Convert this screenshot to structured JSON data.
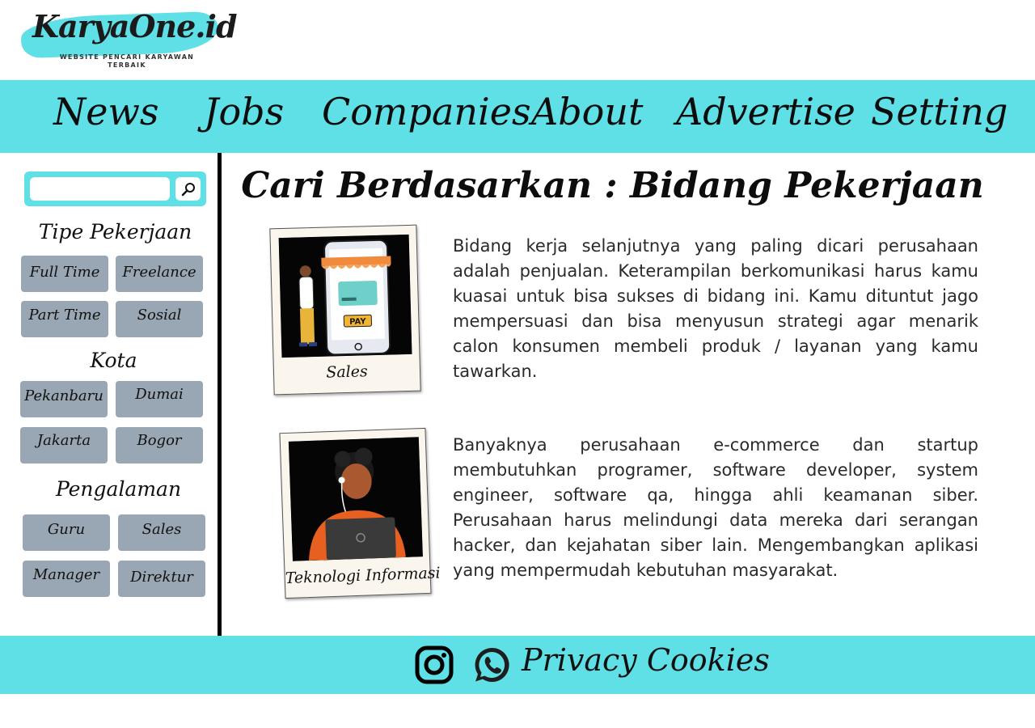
{
  "brand": {
    "name": "KaryaOne.id",
    "tagline": "WEBSITE PENCARI KARYAWAN TERBAIK",
    "accent_color": "#5ee0e6"
  },
  "nav": {
    "items": [
      "News",
      "Jobs",
      "Companies",
      "About",
      "Advertise",
      "Setting"
    ]
  },
  "sidebar": {
    "search": {
      "placeholder": "",
      "value": "",
      "button_icon": "search-icon"
    },
    "sections": [
      {
        "title": "Tipe Pekerjaan",
        "options": [
          "Full Time",
          "Freelance",
          "Part Time",
          "Sosial"
        ]
      },
      {
        "title": "Kota",
        "options": [
          "Pekanbaru",
          "Dumai",
          "Jakarta",
          "Bogor"
        ]
      },
      {
        "title": "Pengalaman",
        "options": [
          "Guru",
          "Sales",
          "Manager",
          "Direktur"
        ]
      }
    ],
    "chip_color": "#99a6b3"
  },
  "main": {
    "title": "Cari Berdasarkan : Bidang Pekerjaan",
    "fields": [
      {
        "caption": "Sales",
        "description": "Bidang kerja selanjutnya yang paling dicari perusahaan adalah penjualan. Keterampilan berkomunikasi harus kamu kuasai untuk bisa sukses di bidang ini. Kamu dituntut jago mempersuasi dan bisa menyusun strategi agar menarik calon konsumen membeli produk / layanan yang kamu tawarkan.",
        "image_label": "PAY"
      },
      {
        "caption": "Teknologi Informasi",
        "description": "Banyaknya perusahaan e-commerce dan startup membutuhkan programer, software developer, system engineer, software qa, hingga ahli keamanan siber. Perusahaan harus melindungi data mereka dari serangan hacker, dan kejahatan siber lain. Mengembangkan aplikasi yang mempermudah kebutuhan masyarakat."
      }
    ]
  },
  "footer": {
    "icons": [
      "instagram-icon",
      "whatsapp-icon"
    ],
    "link": "Privacy Cookies"
  }
}
